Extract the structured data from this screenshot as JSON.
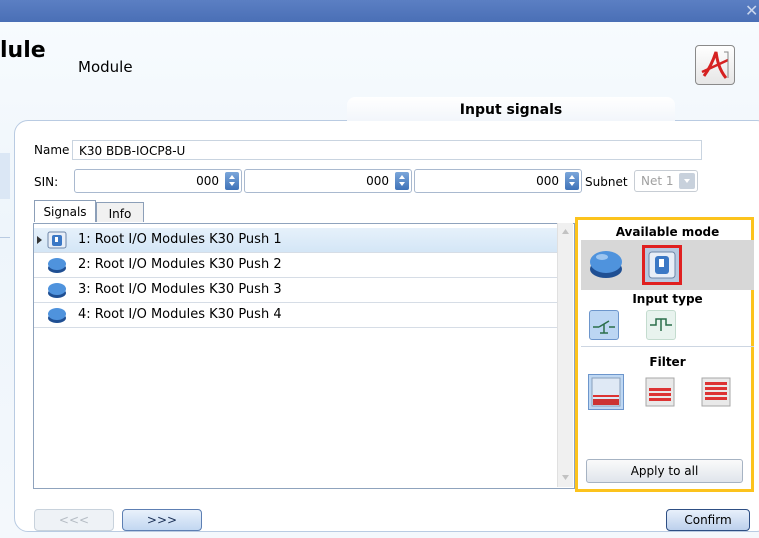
{
  "header": {
    "title": "lule",
    "subtitle": "Module",
    "pdf_icon": "pdf-document-icon"
  },
  "section_tab": {
    "label": "Input signals"
  },
  "form": {
    "name_label": "Name",
    "name_value": "K30 BDB-IOCP8-U",
    "sin_label": "SIN:",
    "sin_values": [
      "000",
      "000",
      "000"
    ],
    "subnet_label": "Subnet",
    "subnet_value": "Net 1"
  },
  "tabs": [
    {
      "label": "Signals"
    },
    {
      "label": "Info"
    }
  ],
  "signals": [
    {
      "label": "1: Root I/O Modules K30 Push 1",
      "icon": "switch-icon",
      "selected": true
    },
    {
      "label": "2: Root I/O Modules K30 Push 2",
      "icon": "pushbutton-icon"
    },
    {
      "label": "3: Root I/O Modules K30 Push 3",
      "icon": "pushbutton-icon"
    },
    {
      "label": "4: Root I/O Modules K30 Push 4",
      "icon": "pushbutton-icon"
    }
  ],
  "right_panel": {
    "available_mode_label": "Available mode",
    "input_type_label": "Input type",
    "filter_label": "Filter",
    "apply_label": "Apply to all"
  },
  "footer": {
    "prev_label": "<<<",
    "next_label": ">>>",
    "confirm_label": "Confirm"
  },
  "colors": {
    "highlight_border": "#fcc31d",
    "selection_border": "#e02020",
    "titlebar": "#4a6fb6"
  }
}
